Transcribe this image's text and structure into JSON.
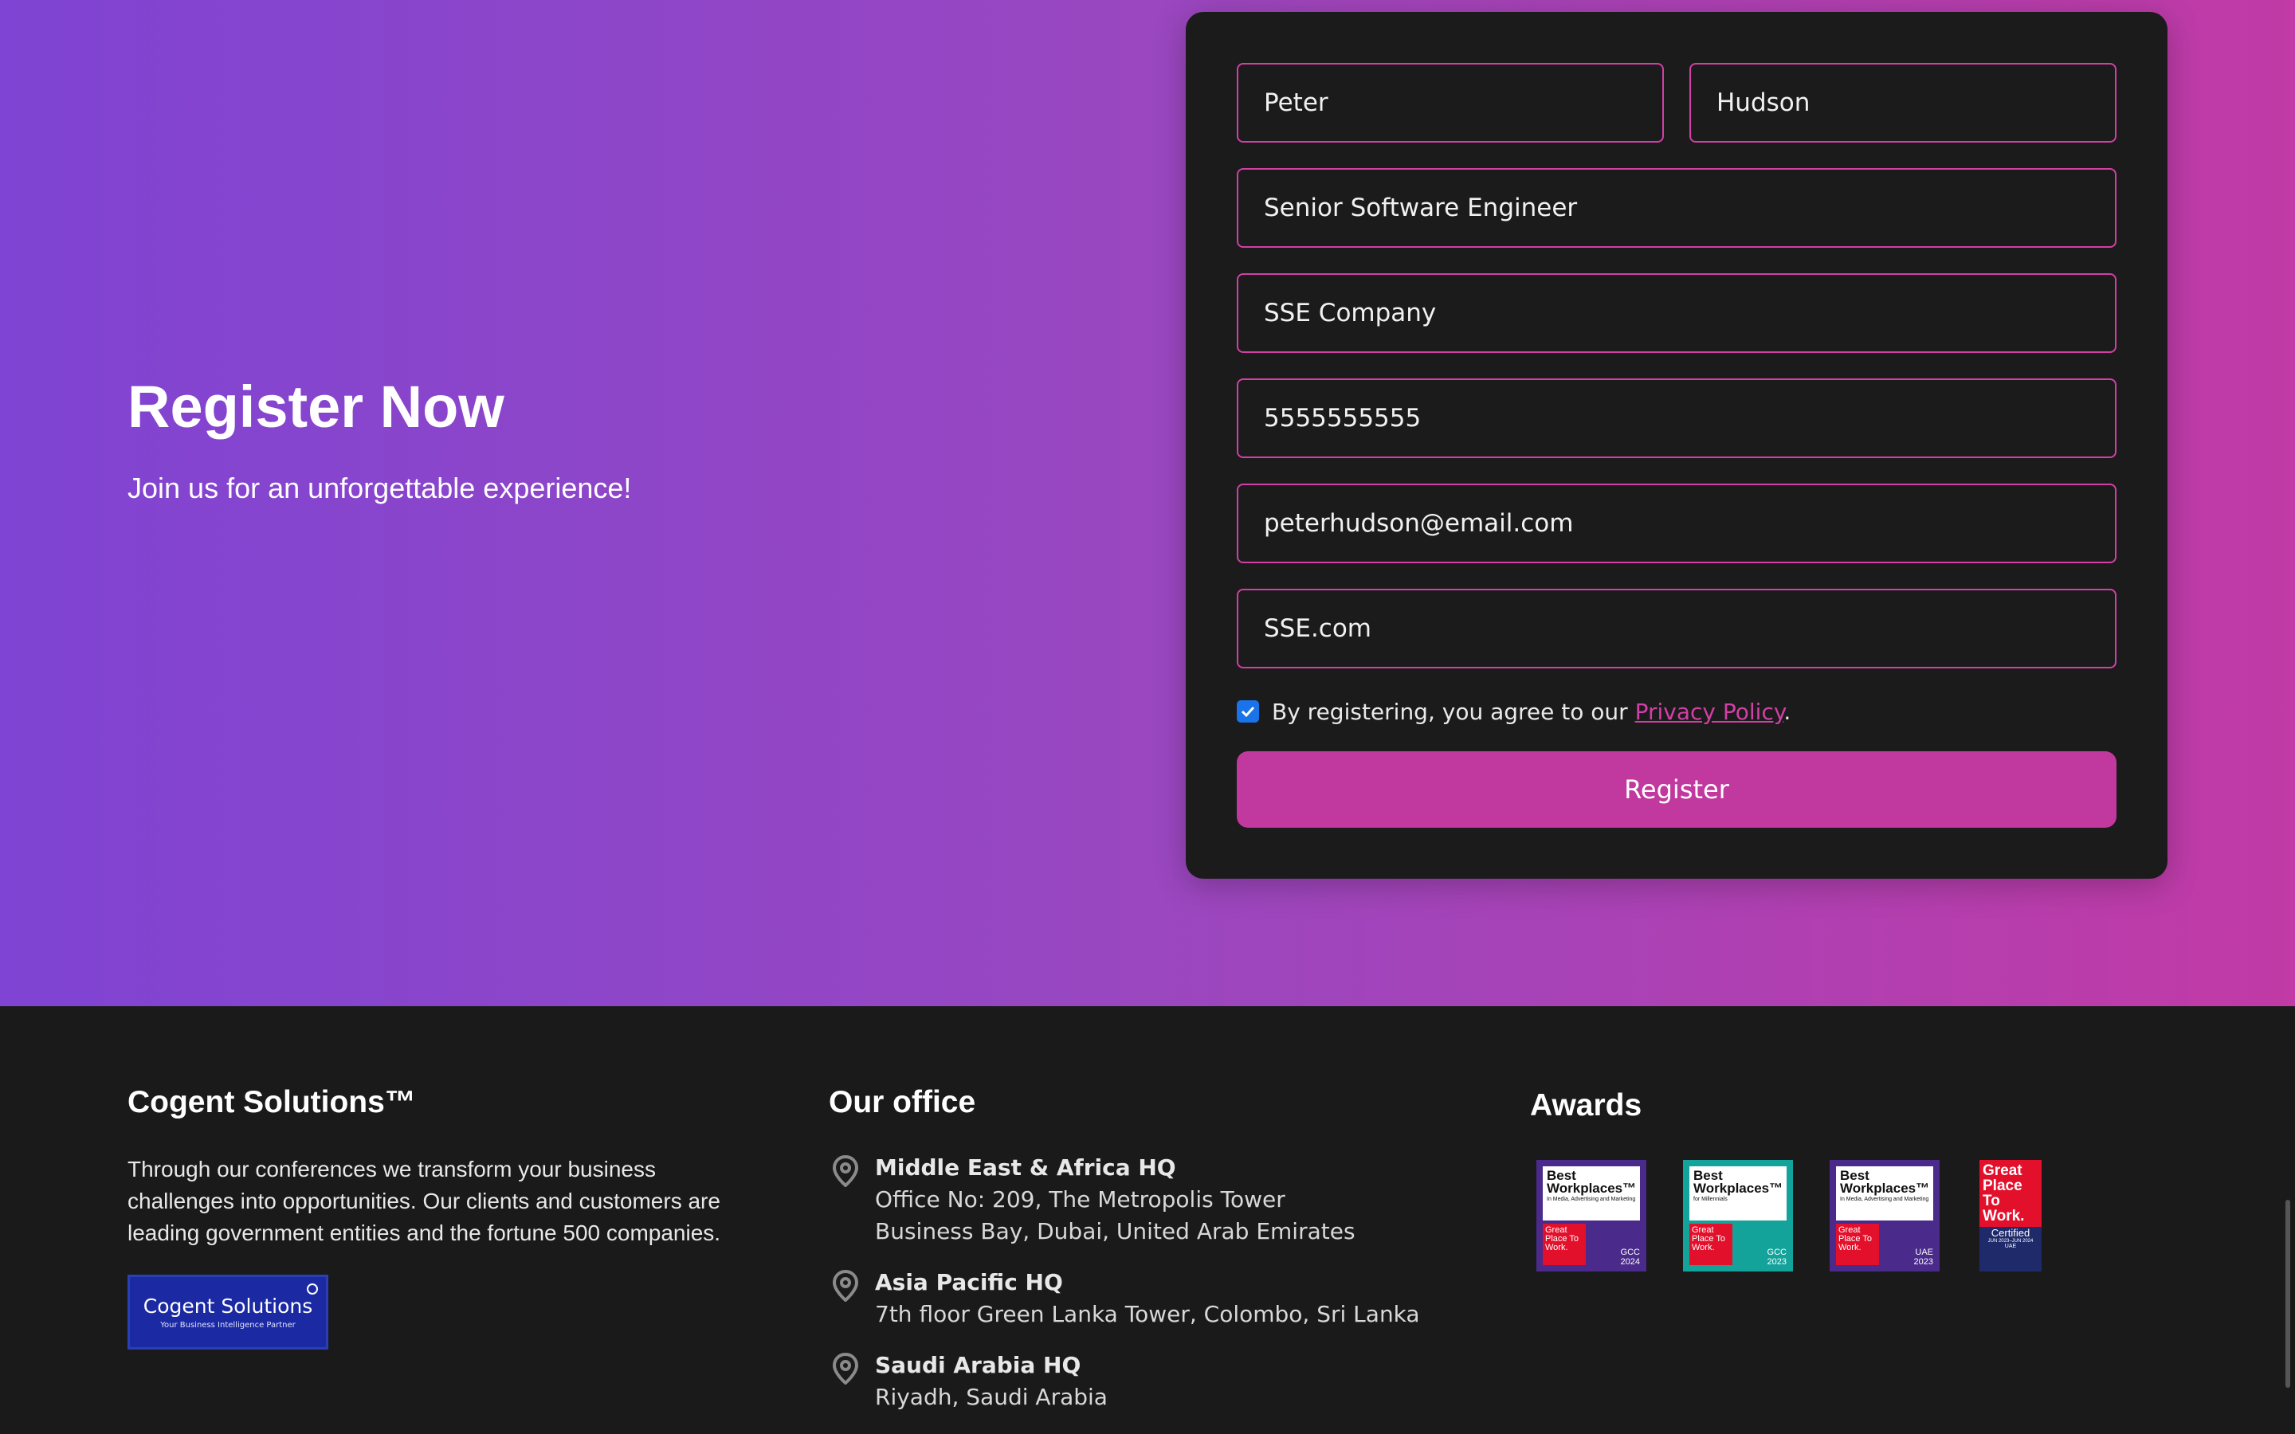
{
  "hero": {
    "title": "Register Now",
    "subtitle": "Join us for an unforgettable experience!"
  },
  "form": {
    "first_name": "Peter",
    "last_name": "Hudson",
    "job_title": "Senior Software Engineer",
    "company": "SSE Company",
    "phone": "5555555555",
    "email": "peterhudson@email.com",
    "website": "SSE.com",
    "consent_checked": true,
    "consent_text": "By registering, you agree to our ",
    "consent_link": "Privacy Policy",
    "consent_end": ".",
    "register_label": "Register"
  },
  "footer": {
    "brand": {
      "title": "Cogent Solutions™",
      "description": "Through our conferences we transform your business challenges into opportunities. Our clients and customers are leading government entities and the fortune 500 companies.",
      "logo_name": "Cogent Solutions",
      "logo_tagline": "Your Business Intelligence Partner"
    },
    "offices": {
      "title": "Our office",
      "items": [
        {
          "name": "Middle East & Africa HQ",
          "line1": "Office No: 209, The Metropolis Tower",
          "line2": "Business Bay, Dubai, United Arab Emirates"
        },
        {
          "name": "Asia Pacific HQ",
          "line1": "7th floor Green Lanka Tower, Colombo, Sri Lanka",
          "line2": ""
        },
        {
          "name": "Saudi Arabia HQ",
          "line1": "Riyadh, Saudi Arabia",
          "line2": ""
        }
      ]
    },
    "awards": {
      "title": "Awards",
      "badges": [
        {
          "heading": "Best Workplaces™",
          "sub": "In Media, Advertising and Marketing",
          "gptw": "Great Place To Work.",
          "region": "GCC",
          "year": "2024",
          "color": "#4a2a8a"
        },
        {
          "heading": "Best Workplaces™",
          "sub": "for Millennials",
          "gptw": "Great Place To Work.",
          "region": "GCC",
          "year": "2023",
          "color": "#13a39b"
        },
        {
          "heading": "Best Workplaces™",
          "sub": "In Media, Advertising and Marketing",
          "gptw": "Great Place To Work.",
          "region": "UAE",
          "year": "2023",
          "color": "#4a2a8a"
        },
        {
          "heading": "Great Place To Work.",
          "sub": "Certified",
          "gptw": "JUN 2023–JUN 2024",
          "region": "UAE",
          "year": "",
          "color": "#e3102c"
        }
      ]
    }
  }
}
